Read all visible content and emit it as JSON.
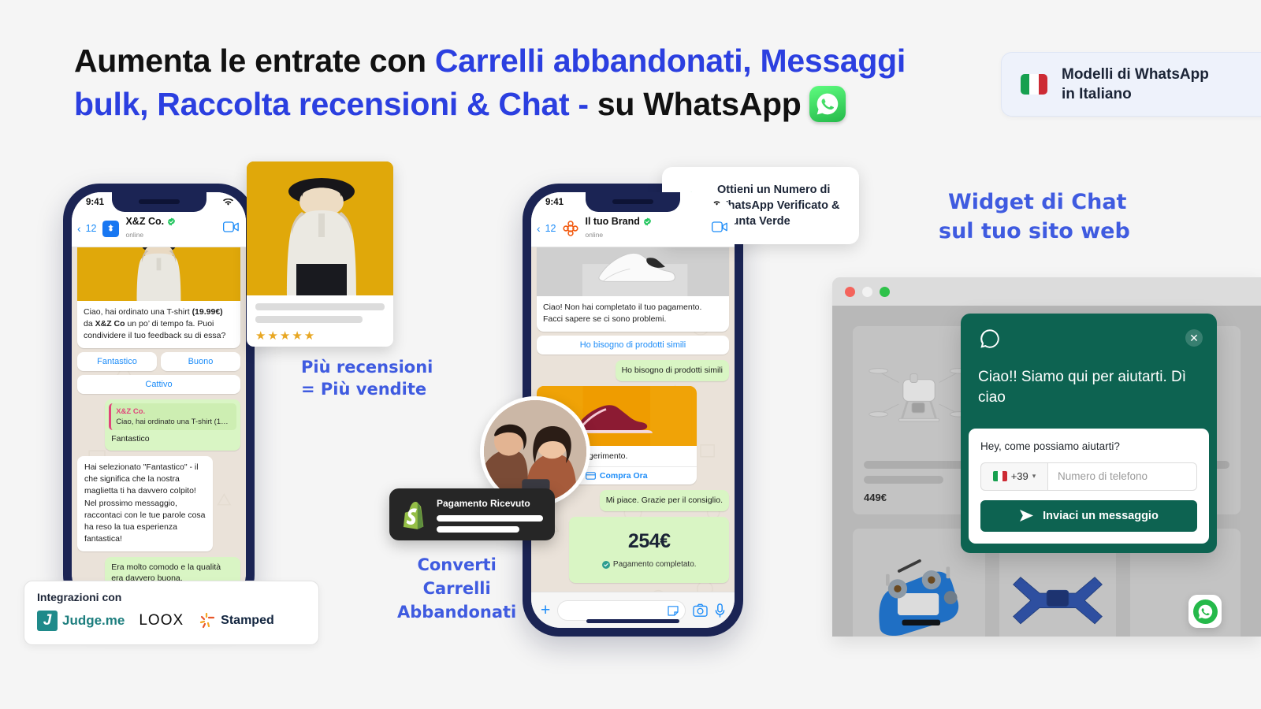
{
  "headline": {
    "part1": "Aumenta le entrate con ",
    "highlight1": "Carrelli abbandonati, Messaggi bulk, Raccolta recensioni & Chat -",
    "part2": " su WhatsApp",
    "icon": "whatsapp-icon"
  },
  "lang_badge": {
    "line1": "Modelli di WhatsApp",
    "line2": "in Italiano",
    "flag": "italy-flag-icon"
  },
  "phone_reviews": {
    "status_time": "9:41",
    "back_count": "12",
    "contact_name": "X&Z Co.",
    "contact_status": "online",
    "card_text_1": "Ciao, hai ordinato una T-shirt ",
    "card_text_bold_1": "(19.99€)",
    "card_text_2": " da ",
    "card_text_bold_2": "X&Z Co",
    "card_text_3": " un po’ di tempo fa. Puoi condividere il tuo feedback su di essa?",
    "quick_replies": [
      "Fantastico",
      "Buono",
      "Cattivo"
    ],
    "quote_name": "X&Z Co.",
    "quote_text": "Ciao, hai ordinato una T-shirt (19.99€) da...",
    "reply_sent": "Fantastico",
    "bot_reply": "Hai selezionato \"Fantastico\" - il che significa che la nostra maglietta ti ha davvero colpito! Nel prossimo messaggio, raccontaci con le tue parole cosa ha reso la tua esperienza fantastica!",
    "user_reply": "Era molto comodo e la qualità era davvero buona."
  },
  "review_card": {
    "stars": "★★★★★",
    "star_count": 5
  },
  "hand_notes": {
    "reviews_l1": "Più recensioni",
    "reviews_l2": "= Più vendite",
    "carts_l1": "Converti",
    "carts_l2": "Carrelli",
    "carts_l3": "Abbandonati",
    "widget_l1": "Widget di Chat",
    "widget_l2": "sul tuo sito web"
  },
  "verified_box": {
    "line1": "Ottieni un Numero di",
    "line2": "WhatsApp Verificato &",
    "line3": "Spunta Verde",
    "icon": "verified-badge-icon"
  },
  "phone_cart": {
    "status_time": "9:41",
    "back_count": "12",
    "contact_name": "Il tuo Brand",
    "contact_status": "online",
    "msg_abandoned": "Ciao! Non hai completato il tuo pagamento. Facci sapere se ci sono problemi.",
    "quick_reply": "Ho bisogno di prodotti simili",
    "user_reply": "Ho bisogno di prodotti simili",
    "product_caption": "Ecco un suggerimento.",
    "buy_button": "Compra Ora",
    "thanks_reply": "Mi piace. Grazie per il consiglio.",
    "amount": "254€",
    "payment_status": "Pagamento completato."
  },
  "shopify_toast": {
    "title": "Pagamento Ricevuto",
    "icon": "shopify-icon"
  },
  "integrations": {
    "caption": "Integrazioni con",
    "items": [
      "Judge.me",
      "LOOX",
      "Stamped"
    ]
  },
  "browser": {
    "products": [
      {
        "name": "drone",
        "price": "449€"
      },
      {
        "name": "rc-controller",
        "price": ""
      },
      {
        "name": "quadcopter-frame",
        "price": ""
      }
    ]
  },
  "chat_widget": {
    "greeting": "Ciao!! Siamo qui per aiutarti. Dì ciao",
    "question": "Hey, come possiamo aiutarti?",
    "country_code": "+39",
    "phone_placeholder": "Numero di telefono",
    "send_label": "Inviaci un messaggio",
    "close_icon": "close-icon",
    "brand_color": "#0d6351"
  },
  "colors": {
    "accent_blue": "#2b3fe0",
    "whatsapp_green": "#25b94a",
    "hand_blue": "#3f5be0"
  }
}
